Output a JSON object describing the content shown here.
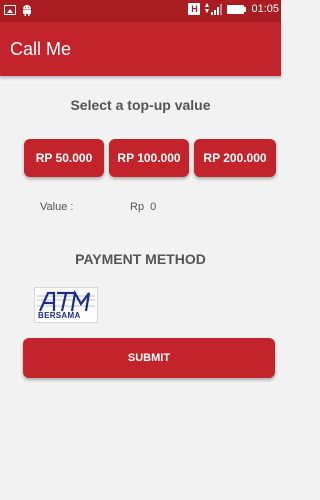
{
  "status_bar": {
    "time": "01:05",
    "network_badge": "H",
    "left_icons": [
      "image-icon",
      "android-icon"
    ],
    "right_icons": [
      "network-type-icon",
      "data-arrows-icon",
      "signal-icon",
      "battery-icon"
    ]
  },
  "app_bar": {
    "title": "Call Me"
  },
  "topup": {
    "heading": "Select a top-up value",
    "options": [
      "RP 50.000",
      "RP 100.000",
      "RP 200.000"
    ]
  },
  "value": {
    "label": "Value :",
    "amount": "Rp  0"
  },
  "payment": {
    "heading": "PAYMENT METHOD",
    "methods": [
      {
        "name": "ATM BERSAMA",
        "logo_text": "ATM",
        "logo_subtext": "BERSAMA"
      }
    ]
  },
  "submit": {
    "label": "SUBMIT"
  },
  "colors": {
    "primary": "#c3232b",
    "status_bar": "#a81c22",
    "background": "#f2f2f2",
    "text_secondary": "#555555",
    "atm_blue": "#1b2c86"
  }
}
